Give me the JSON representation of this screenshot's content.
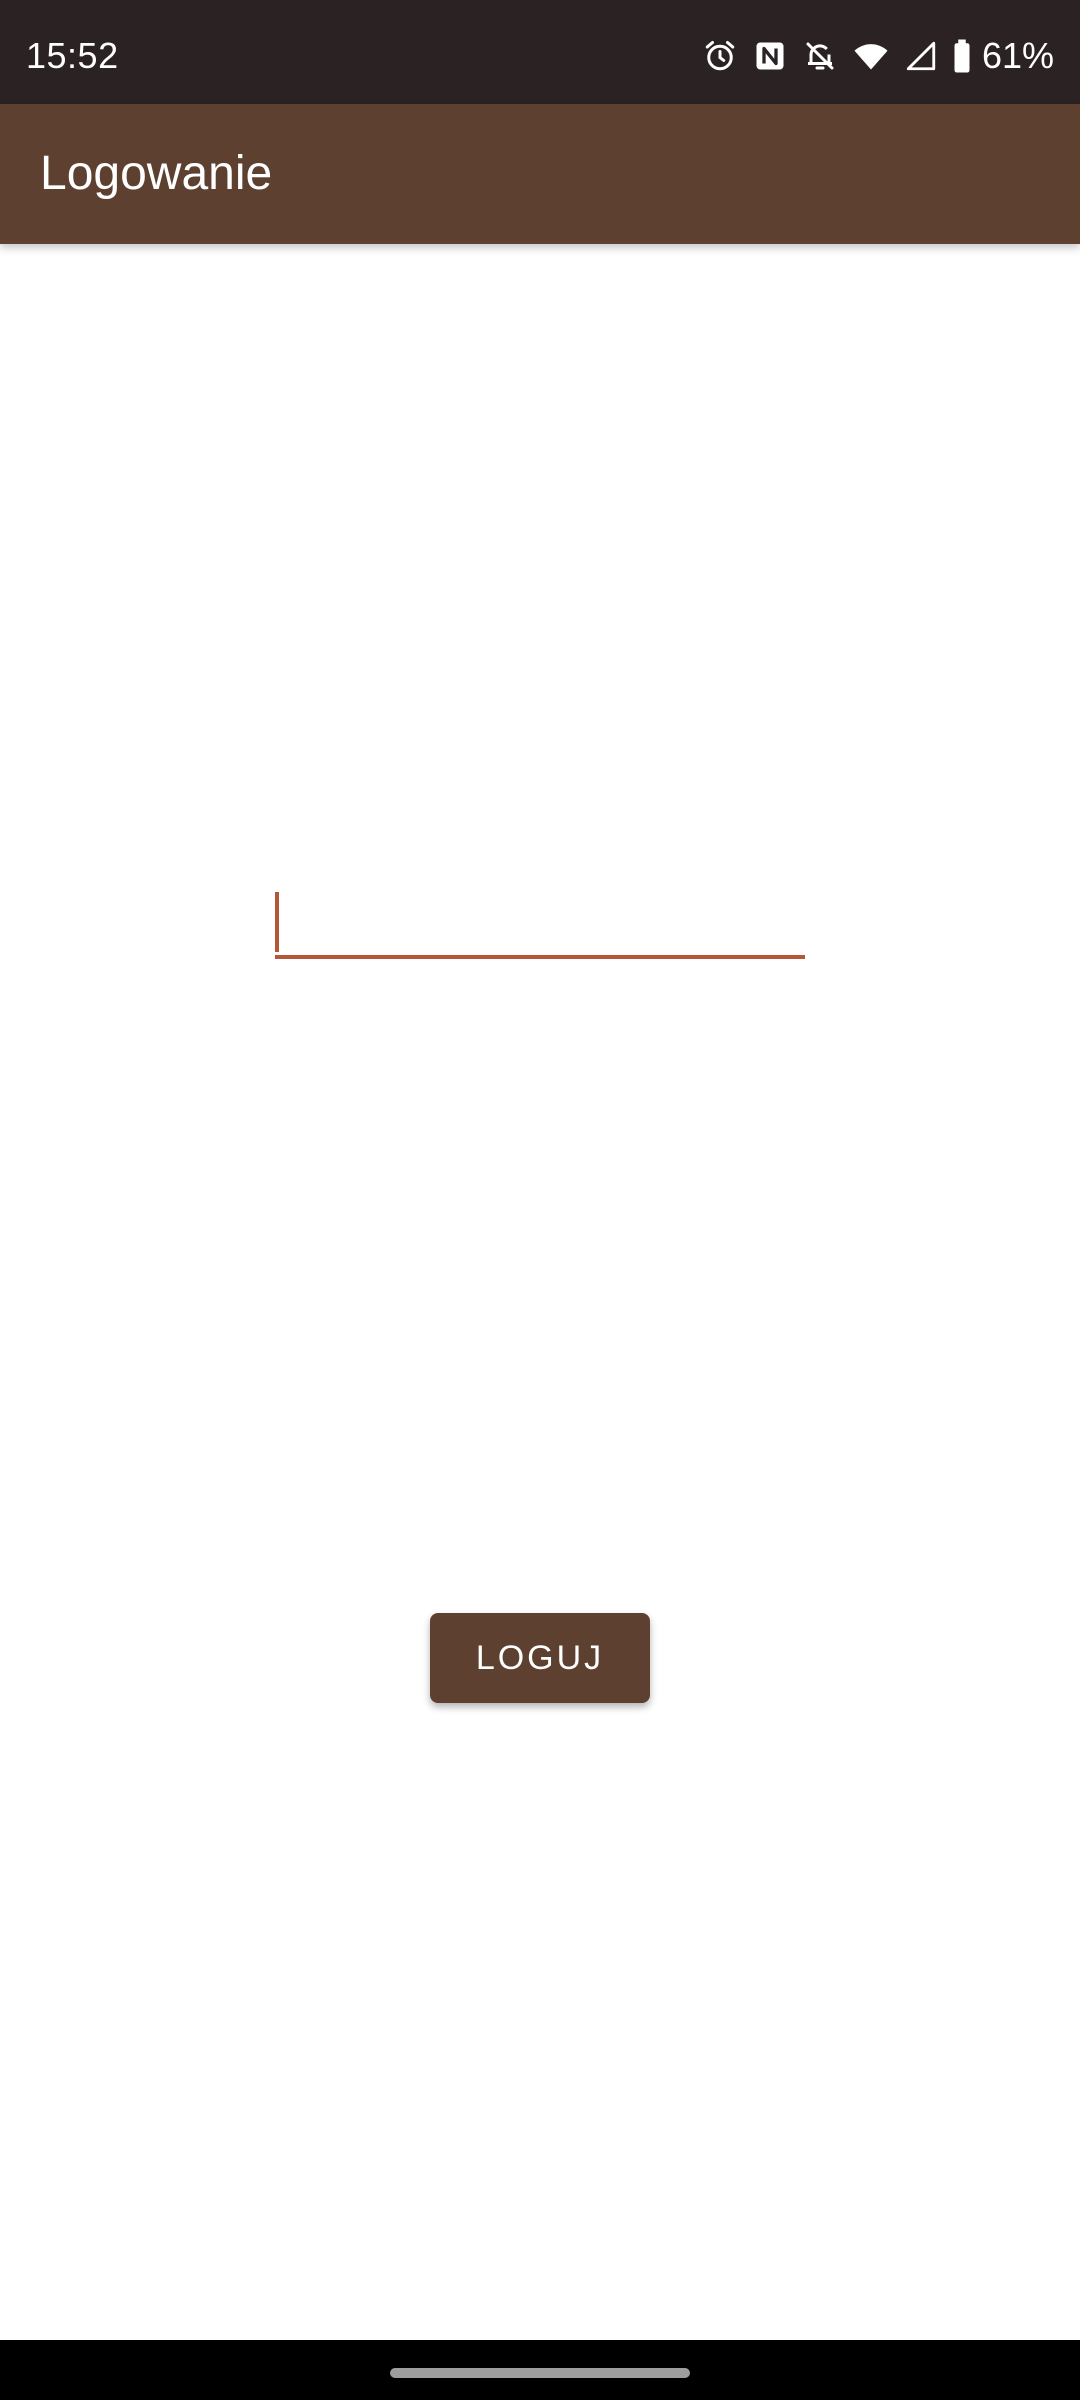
{
  "status_bar": {
    "time": "15:52",
    "battery": "61%",
    "icons": [
      "alarm-icon",
      "nfc-icon",
      "bell-off-icon",
      "wifi-icon",
      "signal-icon",
      "battery-icon"
    ]
  },
  "app_bar": {
    "title": "Logowanie",
    "color": "#5d4030"
  },
  "login_form": {
    "input_value": "",
    "input_placeholder": "",
    "accent_color": "#b5563b",
    "button_label": "LOGUJ"
  }
}
